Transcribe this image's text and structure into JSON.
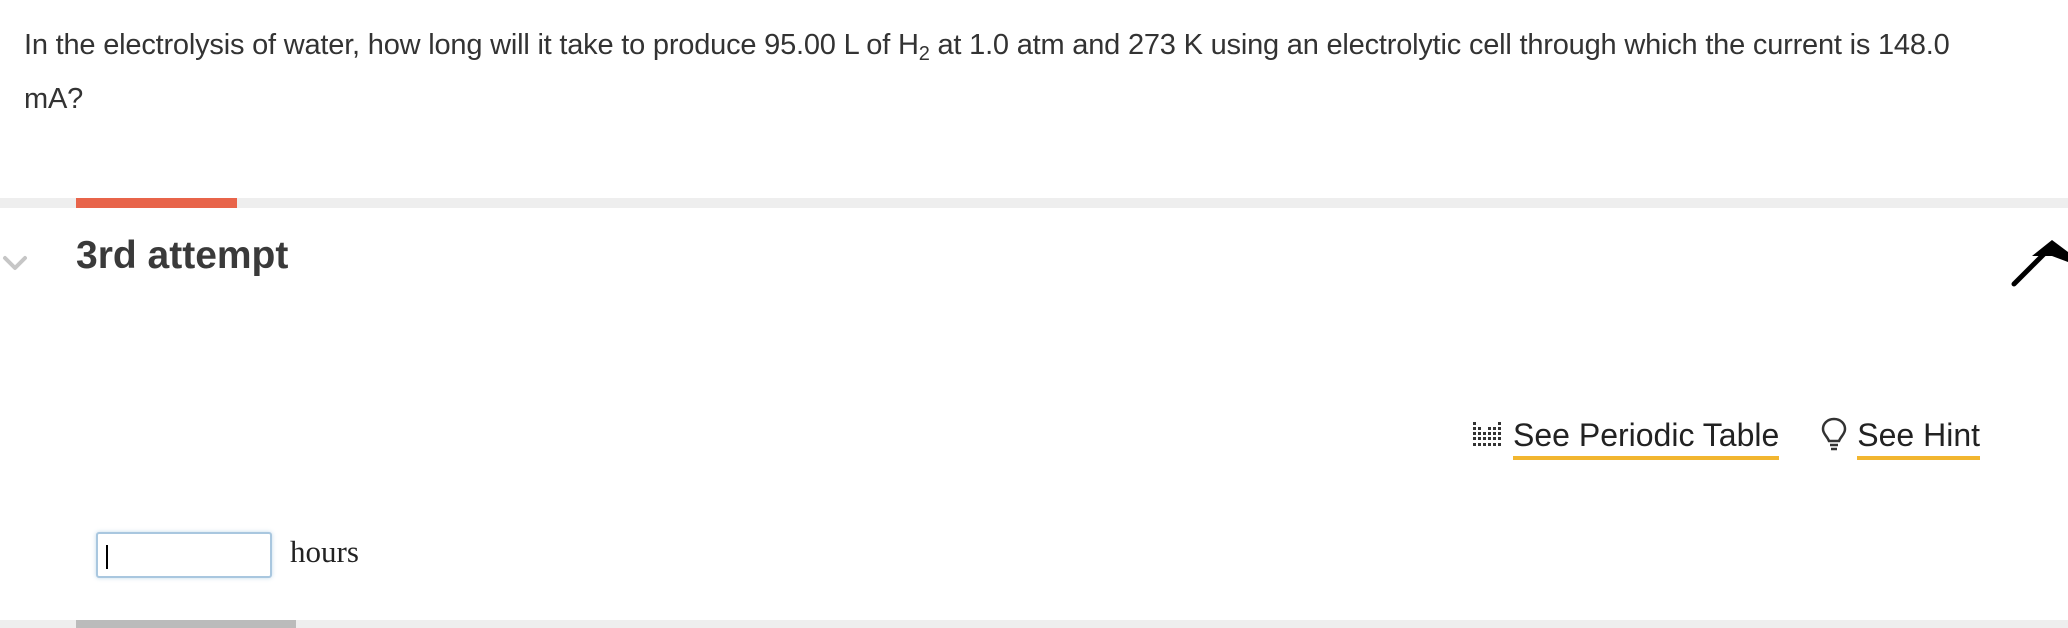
{
  "question": {
    "text_before": "In the electrolysis of water, how long will it take to produce 95.00 L of H",
    "subscript": "2",
    "text_after": " at 1.0 atm and 273 K using an electrolytic cell through which the current is 148.0 mA?"
  },
  "attempt": {
    "title": "3rd attempt",
    "progress_fraction": 0.078,
    "accent_color": "#e8644a"
  },
  "tools": {
    "periodic_table": {
      "label": "See Periodic Table",
      "icon": "periodic-table-icon"
    },
    "hint": {
      "label": "See Hint",
      "icon": "lightbulb-icon"
    },
    "underline_color": "#f2b630"
  },
  "answer": {
    "value": "",
    "unit": "hours"
  }
}
